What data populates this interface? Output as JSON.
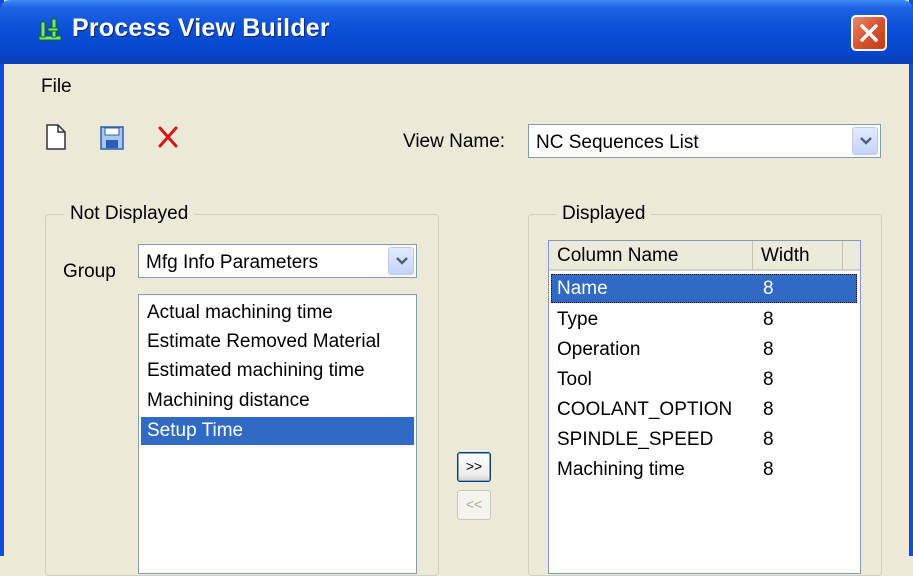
{
  "window": {
    "title": "Process View Builder"
  },
  "menu": {
    "file": "File"
  },
  "toolbar": {
    "new_icon": "new-document-icon",
    "save_icon": "save-disk-icon",
    "delete_icon": "delete-x-icon"
  },
  "view_name": {
    "label": "View Name:",
    "value": "NC Sequences List"
  },
  "not_displayed": {
    "title": "Not Displayed",
    "group_label": "Group",
    "group_value": "Mfg Info Parameters",
    "items": [
      {
        "label": "Actual machining time",
        "selected": false
      },
      {
        "label": "Estimate Removed Material",
        "selected": false
      },
      {
        "label": "Estimated machining time",
        "selected": false
      },
      {
        "label": "Machining distance",
        "selected": false
      },
      {
        "label": "Setup Time",
        "selected": true
      }
    ]
  },
  "buttons": {
    "add": ">>",
    "remove": "<<"
  },
  "displayed": {
    "title": "Displayed",
    "columns": [
      "Column Name",
      "Width"
    ],
    "rows": [
      {
        "name": "Name",
        "width": "8",
        "selected": true
      },
      {
        "name": "Type",
        "width": "8",
        "selected": false
      },
      {
        "name": "Operation",
        "width": "8",
        "selected": false
      },
      {
        "name": "Tool",
        "width": "8",
        "selected": false
      },
      {
        "name": "COOLANT_OPTION",
        "width": "8",
        "selected": false
      },
      {
        "name": "SPINDLE_SPEED",
        "width": "8",
        "selected": false
      },
      {
        "name": "Machining time",
        "width": "8",
        "selected": false
      }
    ]
  },
  "colors": {
    "title_bar": "#0a50d9",
    "selection": "#316ac5",
    "face": "#ece9d8",
    "close": "#d9532d"
  }
}
